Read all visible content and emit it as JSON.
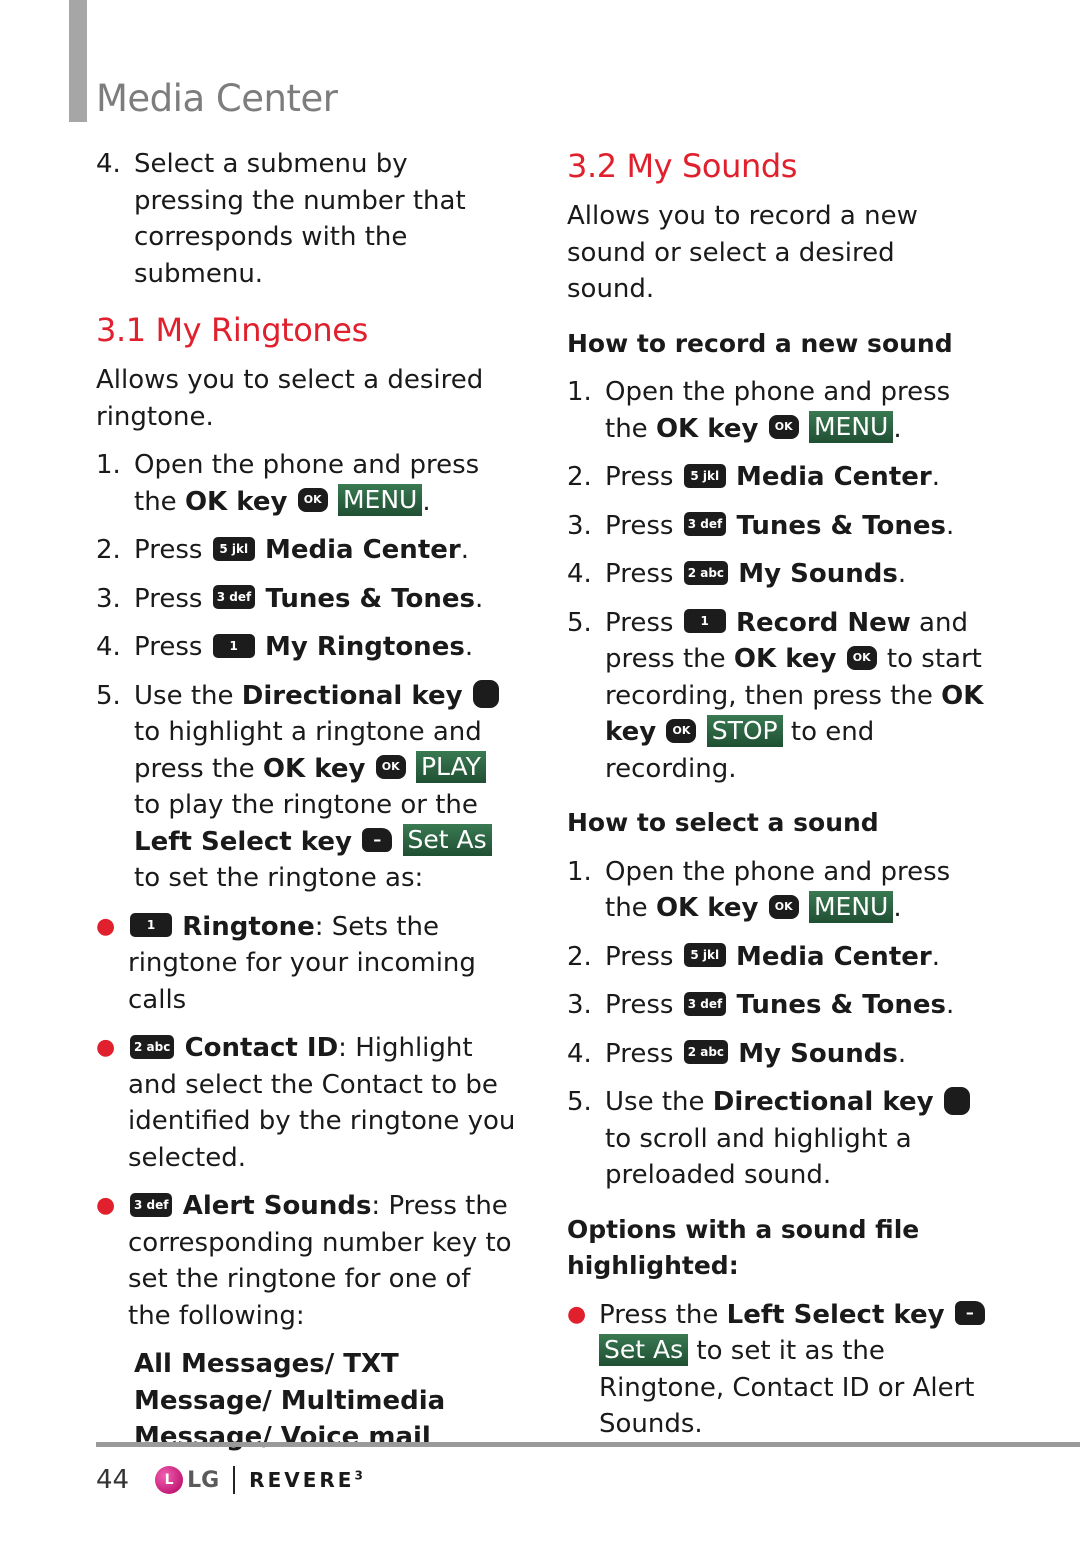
{
  "header": {
    "title": "Media Center"
  },
  "left_column": {
    "intro_step": {
      "num": "4.",
      "text": "Select a submenu by pressing the number that corresponds with the submenu."
    },
    "section": {
      "heading": "3.1 My Ringtones",
      "description": "Allows you to select a desired ringtone.",
      "steps": [
        {
          "num": "1.",
          "pre": "Open the phone and press the ",
          "bold": "OK key",
          "key": "OK",
          "softkey": "MENU",
          "post": "."
        },
        {
          "num": "2.",
          "pre": "Press ",
          "key": "5 jkl",
          "bold": "Media Center",
          "post": "."
        },
        {
          "num": "3.",
          "pre": "Press ",
          "key": "3 def",
          "bold": "Tunes & Tones",
          "post": "."
        },
        {
          "num": "4.",
          "pre": "Press ",
          "key": "1",
          "bold": "My Ringtones",
          "post": "."
        }
      ],
      "step5": {
        "num": "5.",
        "t1": "Use the ",
        "b1": "Directional key",
        "t2": " to highlight a ringtone and press the ",
        "b2": "OK key",
        "ok_key": "OK",
        "softkey_play": "PLAY",
        "t3": " to play the ringtone or the ",
        "b3": "Left Select key",
        "softkey_setas": "Set As",
        "t4": " to set the ringtone as:"
      },
      "options": [
        {
          "key": "1",
          "label": "Ringtone",
          "text": ": Sets the ringtone for your incoming calls"
        },
        {
          "key": "2 abc",
          "label": "Contact ID",
          "text": ": Highlight and select the Contact to be identified by the ringtone you selected."
        },
        {
          "key": "3 def",
          "label": "Alert Sounds",
          "text": ": Press the corresponding number key to set the ringtone for one of the following:"
        }
      ],
      "alert_types": "All Messages/ TXT Message/ Multimedia Message/ Voice mail"
    }
  },
  "right_column": {
    "heading": "3.2 My Sounds",
    "description": "Allows you to record a new sound or select a desired sound.",
    "record": {
      "heading": "How to record a new sound",
      "steps": [
        {
          "num": "1.",
          "pre": "Open the phone and press the ",
          "bold": "OK key",
          "key": "OK",
          "softkey": "MENU",
          "post": "."
        },
        {
          "num": "2.",
          "pre": "Press ",
          "key": "5 jkl",
          "bold": "Media Center",
          "post": "."
        },
        {
          "num": "3.",
          "pre": "Press ",
          "key": "3 def",
          "bold": "Tunes & Tones",
          "post": "."
        },
        {
          "num": "4.",
          "pre": "Press ",
          "key": "2 abc",
          "bold": "My Sounds",
          "post": "."
        }
      ],
      "step5": {
        "num": "5.",
        "t1": "Press ",
        "key": "1",
        "b1": "Record New",
        "t2": " and press the ",
        "b2": "OK key",
        "ok_key": "OK",
        "t3": " to start recording, then press the ",
        "b3": "OK key",
        "softkey_stop": "STOP",
        "t4": " to end recording."
      }
    },
    "select": {
      "heading": "How to select a sound",
      "steps": [
        {
          "num": "1.",
          "pre": "Open the phone and press the ",
          "bold": "OK key",
          "key": "OK",
          "softkey": "MENU",
          "post": "."
        },
        {
          "num": "2.",
          "pre": "Press ",
          "key": "5 jkl",
          "bold": "Media Center",
          "post": "."
        },
        {
          "num": "3.",
          "pre": "Press ",
          "key": "3 def",
          "bold": "Tunes & Tones",
          "post": "."
        },
        {
          "num": "4.",
          "pre": "Press ",
          "key": "2 abc",
          "bold": "My Sounds",
          "post": "."
        }
      ],
      "step5": {
        "num": "5.",
        "t1": "Use the ",
        "b1": "Directional key",
        "t2": " to scroll and highlight a preloaded sound."
      }
    },
    "options": {
      "heading": "Options with a sound file highlighted:",
      "bullet": {
        "t1": "Press the ",
        "b1": "Left Select key",
        "softkey": "Set As",
        "t2": " to set it as the Ringtone, Contact ID or Alert Sounds."
      }
    }
  },
  "footer": {
    "page_number": "44",
    "brand": "LG",
    "product": "REVERE",
    "product_sup": "3"
  },
  "colors": {
    "accent_red": "#e0202d",
    "softkey_green": "#2a6a44",
    "title_gray": "#7d7d7d"
  }
}
